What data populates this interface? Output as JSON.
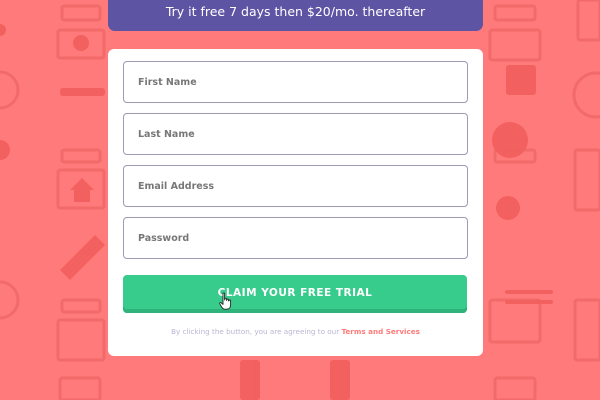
{
  "banner": {
    "text": "Try it free 7 days then $20/mo. thereafter"
  },
  "form": {
    "first_name": {
      "placeholder": "First Name"
    },
    "last_name": {
      "placeholder": "Last Name"
    },
    "email": {
      "placeholder": "Email Address"
    },
    "password": {
      "placeholder": "Password"
    },
    "submit_label": "CLAIM YOUR FREE TRIAL",
    "terms_text": "By clicking the button, you are agreeing to our ",
    "terms_link": "Terms and Services"
  },
  "colors": {
    "background": "#ff7a7a",
    "banner": "#5d54a4",
    "cta": "#38cc8c",
    "link": "#ff7a7a"
  },
  "icons": [
    "hand-pointer-icon"
  ]
}
